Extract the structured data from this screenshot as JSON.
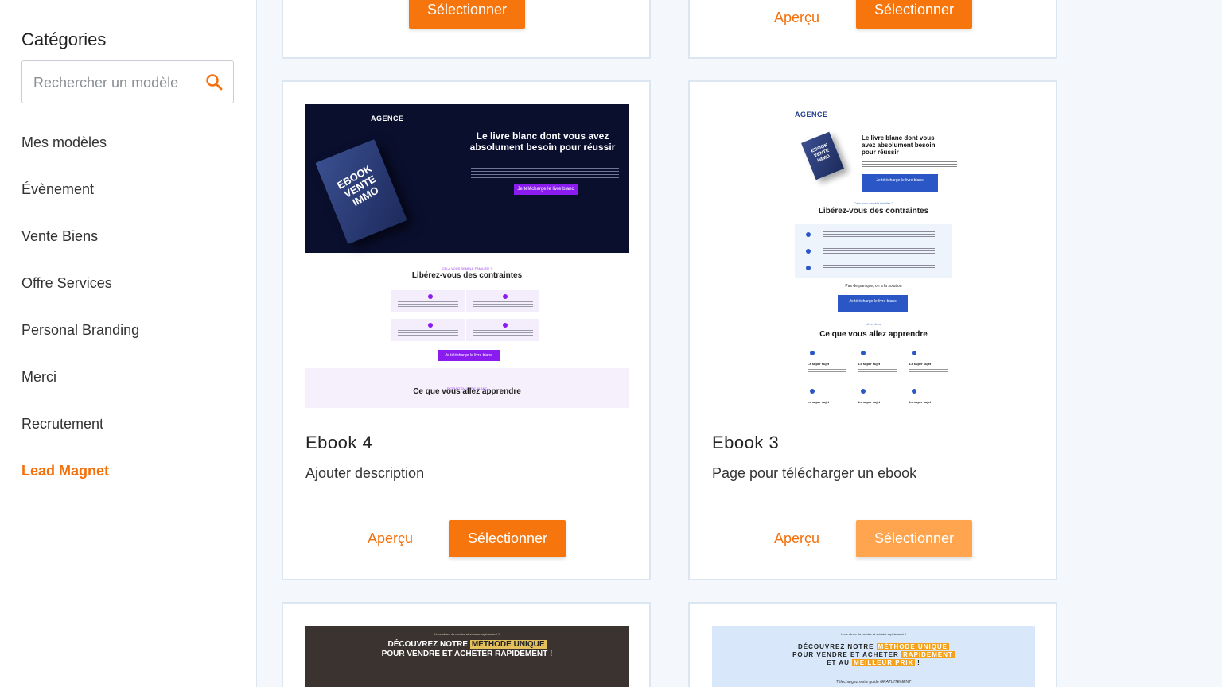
{
  "sidebar": {
    "title": "Catégories",
    "search_placeholder": "Rechercher un modèle",
    "items": [
      {
        "label": "Mes modèles"
      },
      {
        "label": "Évènement"
      },
      {
        "label": "Vente Biens"
      },
      {
        "label": "Offre Services"
      },
      {
        "label": "Personal Branding"
      },
      {
        "label": "Merci"
      },
      {
        "label": "Recrutement"
      },
      {
        "label": "Lead Magnet",
        "active": true
      }
    ]
  },
  "buttons": {
    "preview": "Aperçu",
    "select": "Sélectionner"
  },
  "cards": [
    {
      "title": "Ebook 4",
      "description": "Ajouter description",
      "thumb": {
        "logo": "AGENCE",
        "book": "EBOOK VENTE IMMO",
        "headline": "Le livre blanc dont vous avez absolument besoin pour réussir",
        "cta": "Je télécharge le livre blanc",
        "kicker": "CELA VOUS SEMBLE FAMILIER ?",
        "section1": "Libérez-vous des contraintes",
        "cta2": "Je télécharge le livre blanc",
        "kicker2": "EXTRAIT DU LIVRE BLANC",
        "section2": "Ce que vous allez apprendre"
      }
    },
    {
      "title": "Ebook 3",
      "description": "Page pour télécharger un ebook",
      "thumb": {
        "logo": "AGENCE",
        "book": "EBOOK VENTE IMMO",
        "headline": "Le livre blanc dont vous avez absolument besoin pour réussir",
        "cta": "Je télécharge le livre blanc",
        "kicker": "Cela vous semble familier ?",
        "section1": "Libérez-vous des contraintes",
        "solution": "Pas de panique, on a la solution",
        "cta2": "Je télécharge le livre blanc",
        "kicker2": "Libre blanc",
        "section2": "Ce que vous allez apprendre",
        "feature": "Le super sujet"
      }
    }
  ],
  "bottom_cards": [
    {
      "kicker": "Vous rêvez de vendre et acheter rapidement ?",
      "headline_a": "DÉCOUVREZ NOTRE",
      "headline_mark": "MÉTHODE UNIQUE",
      "headline_b": "POUR VENDRE ET ACHETER RAPIDEMENT !"
    },
    {
      "kicker": "Vous rêvez de vendre et acheter rapidement ?",
      "headline_a": "DÉCOUVREZ NOTRE",
      "headline_mark": "MÉTHODE UNIQUE",
      "headline_b": "POUR VENDRE ET ACHETER",
      "headline_mark2": "RAPIDEMENT",
      "headline_c": "ET AU",
      "headline_mark3": "MEILLEUR PRIX",
      "headline_d": "!",
      "footer": "Téléchargez notre guide GRATUITEMENT"
    }
  ],
  "colors": {
    "accent": "#f6750d",
    "accent_hover": "#ffa44f",
    "card_border": "#dbe6f1",
    "background": "#f4f7fb"
  }
}
